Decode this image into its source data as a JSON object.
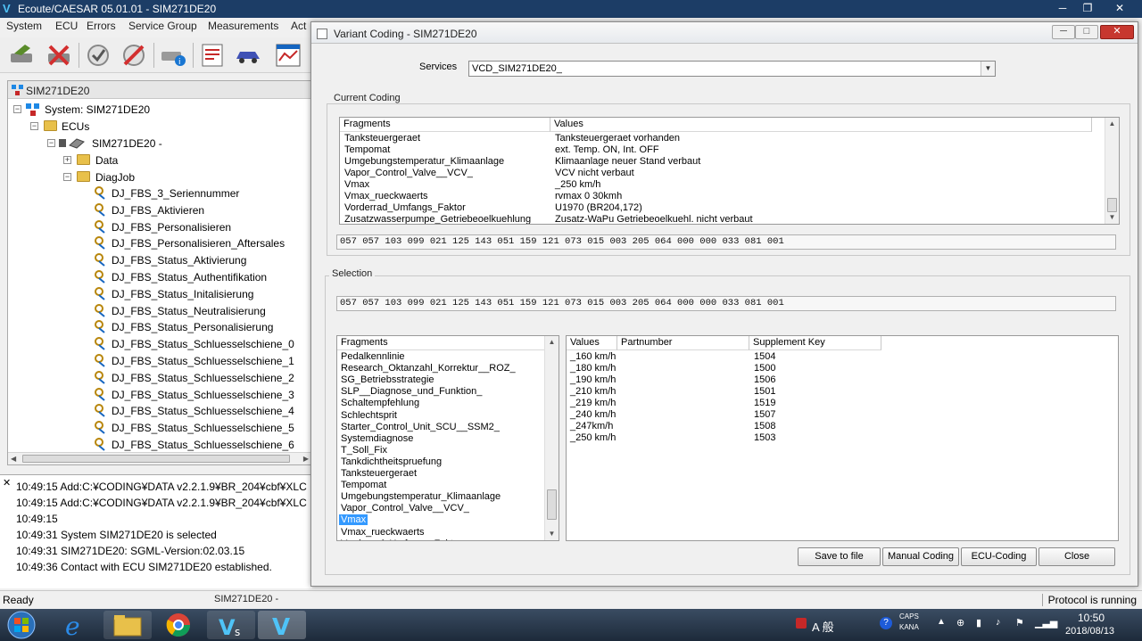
{
  "main_window": {
    "title": "Ecoute/CAESAR 05.01.01 - SIM271DE20",
    "menu": [
      "System",
      "ECU",
      "Errors",
      "Service Group",
      "Measurements",
      "Act"
    ],
    "tree_header": "SIM271DE20",
    "tree": {
      "system": "System: SIM271DE20",
      "ecus": "ECUs",
      "ecu": "SIM271DE20 - ",
      "data": "Data",
      "diagjob": "DiagJob",
      "jobs": [
        "DJ_FBS_3_Seriennummer",
        "DJ_FBS_Aktivieren",
        "DJ_FBS_Personalisieren",
        "DJ_FBS_Personalisieren_Aftersales",
        "DJ_FBS_Status_Aktivierung",
        "DJ_FBS_Status_Authentifikation",
        "DJ_FBS_Status_Initalisierung",
        "DJ_FBS_Status_Neutralisierung",
        "DJ_FBS_Status_Personalisierung",
        "DJ_FBS_Status_Schluesselschiene_0",
        "DJ_FBS_Status_Schluesselschiene_1",
        "DJ_FBS_Status_Schluesselschiene_2",
        "DJ_FBS_Status_Schluesselschiene_3",
        "DJ_FBS_Status_Schluesselschiene_4",
        "DJ_FBS_Status_Schluesselschiene_5",
        "DJ_FBS_Status_Schluesselschiene_6"
      ]
    },
    "log": [
      "10:49:15 Add:C:¥CODING¥DATA v2.2.1.9¥BR_204¥cbf¥XLC",
      "10:49:15 Add:C:¥CODING¥DATA v2.2.1.9¥BR_204¥cbf¥XLC",
      "10:49:15",
      "10:49:31 System SIM271DE20 is selected",
      "10:49:31 SIM271DE20: SGML-Version:02.03.15",
      "10:49:36 Contact with ECU SIM271DE20 established."
    ],
    "status_left": "Ready",
    "status_mid": "SIM271DE20 - ",
    "status_right": "Protocol is running"
  },
  "dialog": {
    "title": "Variant Coding - SIM271DE20",
    "services_label": "Services",
    "services_value": "VCD_SIM271DE20_",
    "current_coding_label": "Current Coding",
    "current_headers": [
      "Fragments",
      "Values"
    ],
    "current_rows": [
      [
        "Tanksteuergeraet",
        "Tanksteuergeraet vorhanden"
      ],
      [
        "Tempomat",
        "ext. Temp. ON, Int. OFF"
      ],
      [
        "Umgebungstemperatur_Klimaanlage",
        "Klimaanlage neuer Stand verbaut"
      ],
      [
        "Vapor_Control_Valve__VCV_",
        "VCV nicht verbaut"
      ],
      [
        "Vmax",
        "_250 km/h"
      ],
      [
        "Vmax_rueckwaerts",
        "rvmax 0 30kmh"
      ],
      [
        "Vorderrad_Umfangs_Faktor",
        "U1970 (BR204,172)"
      ],
      [
        "Zusatzwasserpumpe_Getriebeoelkuehlung",
        "Zusatz-WaPu Getriebeoelkuehl. nicht verbaut"
      ]
    ],
    "current_hex": "057 057 103 099 021 125 143 051 159 121 073 015 003 205 064 000 000 033 081 001",
    "selection_label": "Selection",
    "selection_hex": "057 057 103 099 021 125 143 051 159 121 073 015 003 205 064 000 000 033 081 001",
    "fragments_header": "Fragments",
    "fragments": [
      "Pedalkennlinie",
      "Research_Oktanzahl_Korrektur__ROZ_",
      "SG_Betriebsstrategie",
      "SLP__Diagnose_und_Funktion_",
      "Schaltempfehlung",
      "Schlechtsprit",
      "Starter_Control_Unit_SCU__SSM2_",
      "Systemdiagnose",
      "T_Soll_Fix",
      "Tankdichtheitspruefung",
      "Tanksteuergeraet",
      "Tempomat",
      "Umgebungstemperatur_Klimaanlage",
      "Vapor_Control_Valve__VCV_",
      "Vmax",
      "Vmax_rueckwaerts",
      "Vorderrad_Umfangs_Faktor"
    ],
    "selected_fragment": "Vmax",
    "values_headers": [
      "Values",
      "Partnumber",
      "Supplement Key"
    ],
    "values_rows": [
      [
        "_160 km/h",
        "",
        "1504"
      ],
      [
        "_180 km/h",
        "",
        "1500"
      ],
      [
        "_190 km/h",
        "",
        "1506"
      ],
      [
        "_210 km/h",
        "",
        "1501"
      ],
      [
        "_219 km/h",
        "",
        "1519"
      ],
      [
        "_240 km/h",
        "",
        "1507"
      ],
      [
        "_247km/h",
        "",
        "1508"
      ],
      [
        "_250 km/h",
        "",
        "1503"
      ]
    ],
    "buttons": {
      "save": "Save to file",
      "manual": "Manual Coding",
      "ecu": "ECU-Coding",
      "close": "Close"
    }
  },
  "taskbar": {
    "ime": "A 般",
    "caps": "CAPS",
    "kana": "KANA",
    "time": "10:50",
    "date": "2018/08/13"
  }
}
